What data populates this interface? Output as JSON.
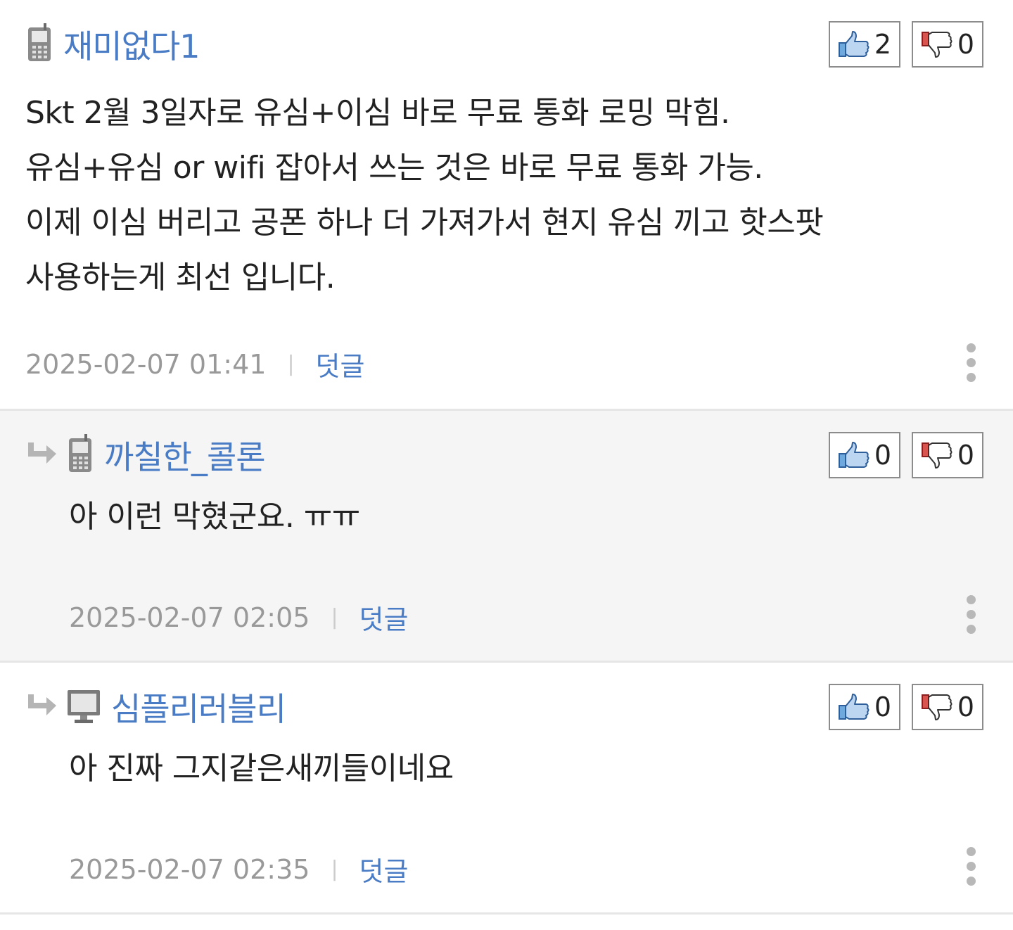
{
  "comments": [
    {
      "author": "재미없다1",
      "device": "mobile-phone-icon",
      "likes": "2",
      "dislikes": "0",
      "lines": [
        "Skt 2월 3일자로 유심+이심 바로 무료 통화 로밍 막힘.",
        "유심+유심 or wifi 잡아서 쓰는 것은 바로 무료 통화 가능.",
        "이제 이심 버리고 공폰 하나 더 가져가서 현지 유심 끼고 핫스팟",
        "사용하는게 최선 입니다."
      ],
      "timestamp": "2025-02-07 01:41",
      "separator": "|",
      "reply_label": "덧글"
    },
    {
      "author": "까칠한_콜론",
      "device": "mobile-phone-icon",
      "likes": "0",
      "dislikes": "0",
      "lines": [
        "아 이런 막혔군요. ㅠㅠ"
      ],
      "timestamp": "2025-02-07 02:05",
      "separator": "|",
      "reply_label": "덧글"
    },
    {
      "author": "심플리러블리",
      "device": "desktop-monitor-icon",
      "likes": "0",
      "dislikes": "0",
      "lines": [
        "아 진짜 그지같은새끼들이네요"
      ],
      "timestamp": "2025-02-07 02:35",
      "separator": "|",
      "reply_label": "덧글"
    }
  ],
  "colors": {
    "link_blue": "#4a7cc5",
    "meta_gray": "#999999",
    "reply_background": "#f5f5f5",
    "divider": "#e6e6e6"
  }
}
